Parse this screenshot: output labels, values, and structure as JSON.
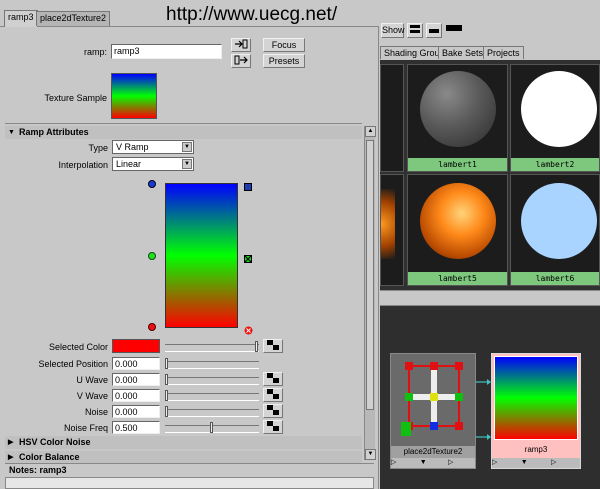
{
  "watermark": "http://www.uecg.net/",
  "editor": {
    "tabs": [
      "ramp3",
      "place2dTexture2"
    ],
    "ramp_label": "ramp:",
    "ramp_name": "ramp3",
    "focus_button": "Focus",
    "presets_button": "Presets",
    "texture_sample_label": "Texture Sample",
    "section_ramp": "Ramp Attributes",
    "type_label": "Type",
    "type_value": "V Ramp",
    "interp_label": "Interpolation",
    "interp_value": "Linear",
    "selected_color_label": "Selected Color",
    "selected_color": "#ff0000",
    "fields": [
      {
        "label": "Selected Position",
        "value": "0.000",
        "slider": 0.0
      },
      {
        "label": "U Wave",
        "value": "0.000",
        "slider": 0.0
      },
      {
        "label": "V Wave",
        "value": "0.000",
        "slider": 0.0
      },
      {
        "label": "Noise",
        "value": "0.000",
        "slider": 0.0
      },
      {
        "label": "Noise Freq",
        "value": "0.500",
        "slider": 0.5
      }
    ],
    "section_hsv": "HSV Color Noise",
    "section_balance": "Color Balance",
    "notes_label": "Notes:  ramp3"
  },
  "hypershade": {
    "show_button": "Show",
    "tabs": [
      "Shading Groups",
      "Bake Sets",
      "Projects"
    ],
    "materials": [
      "lambert1",
      "lambert2",
      "lambert5",
      "lambert6"
    ],
    "nodes": [
      "place2dTexture2",
      "ramp3"
    ]
  },
  "colors": {
    "ramp_top": "#0000ff",
    "ramp_mid": "#00ff00",
    "ramp_bottom": "#ff0000",
    "node_label_bg": "#7ec87e"
  }
}
